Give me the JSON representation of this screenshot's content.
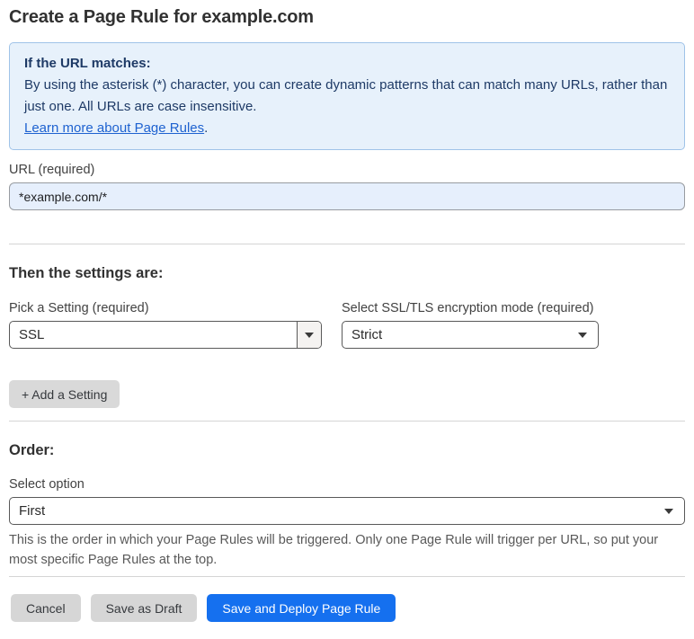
{
  "page": {
    "title": "Create a Page Rule for example.com"
  },
  "info_box": {
    "heading": "If the URL matches:",
    "body": "By using the asterisk (*) character, you can create dynamic patterns that can match many URLs, rather than just one. All URLs are case insensitive.",
    "link_label": "Learn more about Page Rules",
    "link_suffix": "."
  },
  "url_field": {
    "label": "URL (required)",
    "value": "*example.com/*"
  },
  "settings_section": {
    "heading": "Then the settings are:",
    "setting_picker": {
      "label": "Pick a Setting (required)",
      "value": "SSL"
    },
    "ssl_mode_picker": {
      "label": "Select SSL/TLS encryption mode (required)",
      "value": "Strict"
    },
    "add_setting_label": "+ Add a Setting"
  },
  "order_section": {
    "heading": "Order:",
    "select_label": "Select option",
    "value": "First",
    "help_text": "This is the order in which your Page Rules will be triggered. Only one Page Rule will trigger per URL, so put your most specific Page Rules at the top."
  },
  "footer": {
    "cancel_label": "Cancel",
    "save_draft_label": "Save as Draft",
    "save_deploy_label": "Save and Deploy Page Rule"
  },
  "icons": {
    "dropdown_arrow": "triangle-down"
  },
  "colors": {
    "accent_blue": "#1570ef",
    "info_box_bg": "#e7f1fb",
    "info_box_border": "#9fc3e8",
    "info_box_text": "#1e3a66",
    "link_blue": "#1e62d0",
    "url_input_bg": "#e6effc",
    "gray_button_bg": "#d6d6d6",
    "divider": "#d5d5d5"
  }
}
